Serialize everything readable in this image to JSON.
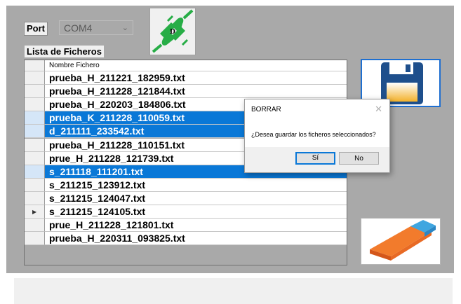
{
  "port": {
    "label": "Port",
    "value": "COM4"
  },
  "connect_button": {
    "letter": "D",
    "icon": "plug-disconnected-icon"
  },
  "file_list": {
    "label": "Lista de Ficheros",
    "column_header": "Nombre Fichero",
    "rows": [
      {
        "name": "prueba_H_211221_182959.txt",
        "selected": false
      },
      {
        "name": "prueba_H_211228_121844.txt",
        "selected": false
      },
      {
        "name": "prueba_H_220203_184806.txt",
        "selected": false
      },
      {
        "name": "prueba_K_211228_110059.txt",
        "selected": true
      },
      {
        "name": "d_211111_233542.txt",
        "selected": true
      },
      {
        "name": "prueba_H_211228_110151.txt",
        "selected": false
      },
      {
        "name": "prue_H_211228_121739.txt",
        "selected": false
      },
      {
        "name": "s_211118_111201.txt",
        "selected": true
      },
      {
        "name": "s_211215_123912.txt",
        "selected": false
      },
      {
        "name": "s_211215_124047.txt",
        "selected": false
      },
      {
        "name": "s_211215_124105.txt",
        "selected": false,
        "current": true
      },
      {
        "name": "prue_H_211228_121801.txt",
        "selected": false
      },
      {
        "name": "prueba_H_220311_093825.txt",
        "selected": false
      }
    ]
  },
  "save_button": {
    "icon": "floppy-disk-icon"
  },
  "erase_button": {
    "icon": "eraser-icon"
  },
  "dialog": {
    "title": "BORRAR",
    "message": "¿Desea guardar los ficheros seleccionados?",
    "yes_label": "Sí",
    "no_label": "No"
  },
  "colors": {
    "selection": "#0a78d7",
    "panel": "#a9a9a9",
    "plug_green": "#27ad46"
  }
}
